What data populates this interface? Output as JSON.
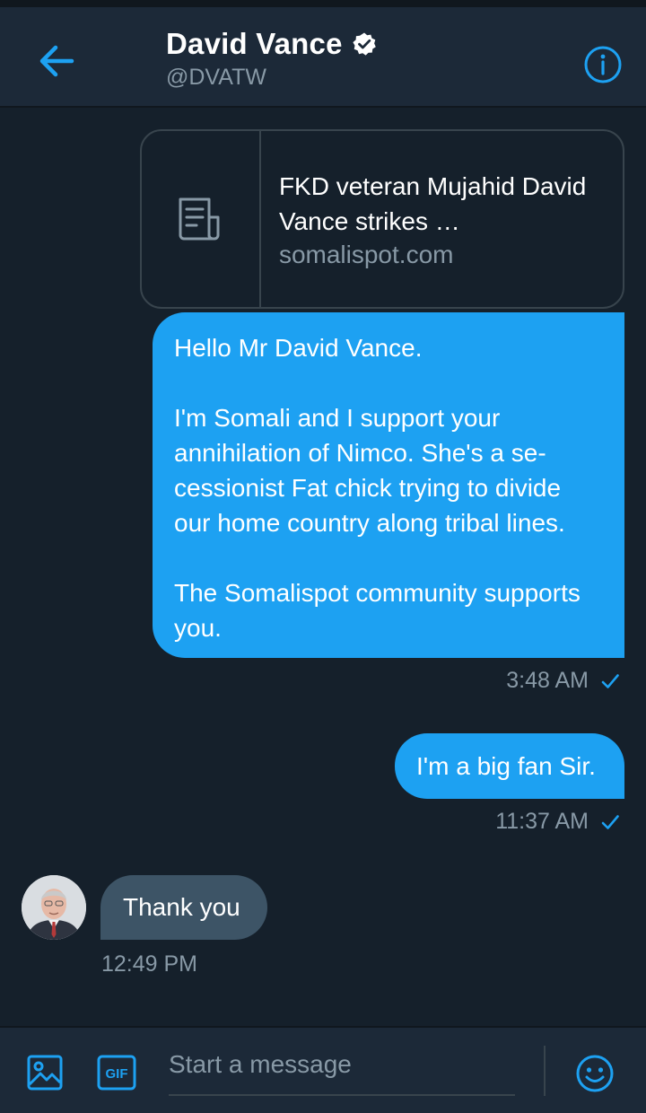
{
  "header": {
    "title": "David Vance",
    "handle": "@DVATW",
    "back_icon": "arrow-left-icon",
    "verified_icon": "verified-badge-icon",
    "info_icon": "info-icon"
  },
  "link_card": {
    "title": "FKD veteran Mujahid David Vance strikes …",
    "domain": "somalispot.com",
    "thumb_icon": "article-icon"
  },
  "messages": [
    {
      "direction": "outgoing",
      "text": "Hello Mr David Vance.\n\nI'm Somali and I support your annihilation of Nimco. She's a se-cessionist Fat chick trying to divide our home country along tribal lines.\n\nThe Somalispot community supports you.",
      "time": "3:48 AM"
    },
    {
      "direction": "outgoing",
      "text": "I'm a big fan Sir.",
      "time": "11:37 AM"
    },
    {
      "direction": "incoming",
      "text": "Thank you",
      "time": "12:49 PM"
    }
  ],
  "composer": {
    "placeholder": "Start a message",
    "gif_label": "GIF",
    "media_icon": "image-icon",
    "emoji_icon": "emoji-icon"
  },
  "colors": {
    "background": "#15202b",
    "bar": "#1c2938",
    "accent": "#1da1f2",
    "incoming_bubble": "#3d5466",
    "muted_text": "#8899a6"
  }
}
